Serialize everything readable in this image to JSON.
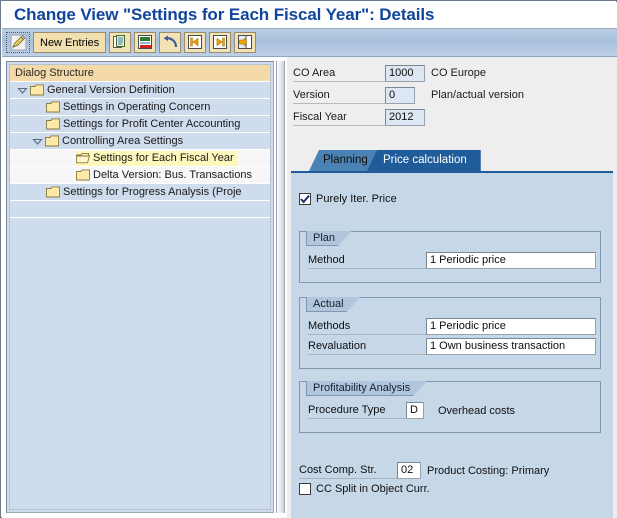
{
  "window": {
    "title": "Change View \"Settings for Each Fiscal Year\": Details"
  },
  "toolbar": {
    "display_change_icon": "pencil-icon",
    "new_entries_label": "New Entries",
    "buttons": [
      {
        "name": "copy-icon",
        "title": "Copy As..."
      },
      {
        "name": "save-delete-icon",
        "title": "Delete"
      },
      {
        "name": "undo-icon",
        "title": "Undo Change"
      },
      {
        "name": "previous-entry-icon",
        "title": "Previous Entry"
      },
      {
        "name": "next-entry-icon",
        "title": "Next Entry"
      },
      {
        "name": "other-entry-icon",
        "title": "Other Entry"
      }
    ]
  },
  "tree": {
    "header": "Dialog Structure",
    "items": [
      {
        "label": "General Version Definition",
        "indent": 0,
        "twisty": "expanded",
        "icon": "folder-icon",
        "selected": false,
        "band": "blue"
      },
      {
        "label": "Settings in Operating Concern",
        "indent": 1,
        "twisty": "none",
        "icon": "folder-icon",
        "selected": false,
        "band": "blue"
      },
      {
        "label": "Settings for Profit Center Accounting",
        "indent": 1,
        "twisty": "none",
        "icon": "folder-icon",
        "selected": false,
        "band": "blue"
      },
      {
        "label": "Controlling Area Settings",
        "indent": 1,
        "twisty": "expanded",
        "icon": "folder-icon",
        "selected": false,
        "band": "blue"
      },
      {
        "label": "Settings for Each Fiscal Year",
        "indent": 2,
        "twisty": "none",
        "icon": "folder-open-icon",
        "selected": true,
        "band": "white"
      },
      {
        "label": "Delta Version: Bus. Transactions",
        "indent": 2,
        "twisty": "none",
        "icon": "folder-icon",
        "selected": false,
        "band": "white"
      },
      {
        "label": "Settings for Progress Analysis (Proje",
        "indent": 1,
        "twisty": "none",
        "icon": "folder-icon",
        "selected": false,
        "band": "blue"
      }
    ]
  },
  "header_fields": [
    {
      "label": "CO Area",
      "value": "1000",
      "description": "CO Europe"
    },
    {
      "label": "Version",
      "value": "0",
      "description": "Plan/actual version"
    },
    {
      "label": "Fiscal Year",
      "value": "2012",
      "description": ""
    }
  ],
  "tabs": [
    {
      "label": "Planning",
      "active": false
    },
    {
      "label": "Price calculation",
      "active": true
    }
  ],
  "panel": {
    "purely_iter_price": {
      "label": "Purely Iter. Price",
      "checked": true
    },
    "plan_group": {
      "title": "Plan",
      "rows": [
        {
          "label": "Method",
          "value": "1 Periodic price"
        }
      ]
    },
    "actual_group": {
      "title": "Actual",
      "rows": [
        {
          "label": "Methods",
          "value": "1 Periodic price"
        },
        {
          "label": "Revaluation",
          "value": "1 Own business transaction"
        }
      ]
    },
    "profitability_group": {
      "title": "Profitability Analysis",
      "rows": [
        {
          "label": "Procedure Type",
          "value": "D",
          "description": "Overhead costs"
        }
      ]
    },
    "cost_comp": {
      "label": "Cost Comp. Str.",
      "value": "02",
      "description": "Product Costing: Primary"
    },
    "cc_split": {
      "label": "CC Split in Object Curr.",
      "checked": false
    }
  },
  "colors": {
    "title_blue": "#10459b",
    "toolbar_blue": "#aec6e0",
    "tab_active": "#1f5c99",
    "tab_inactive": "#4a82b4",
    "panel_bg": "#c6d7e8",
    "tree_row_bg": "#cfdced",
    "tree_header_bg": "#f3daa8",
    "selection_yellow": "#fdf8bb",
    "field_header_bg": "#dce7f3"
  }
}
